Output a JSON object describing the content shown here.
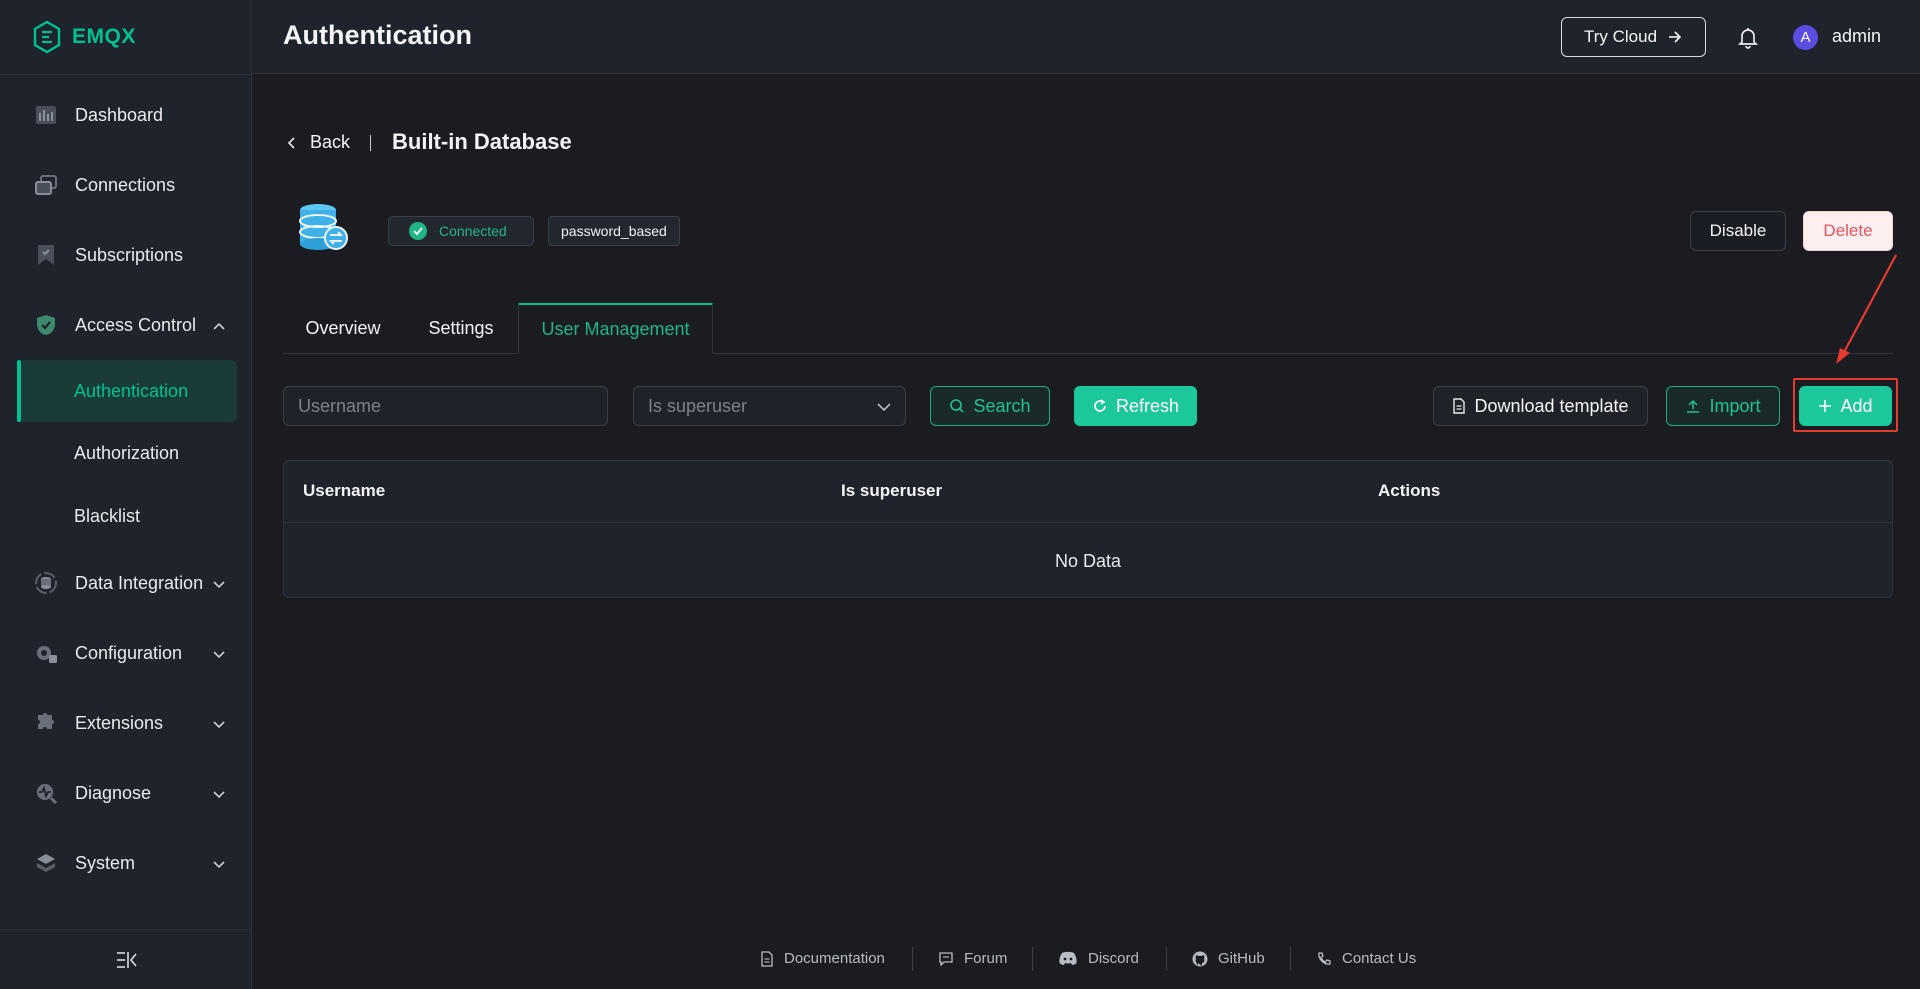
{
  "app": {
    "logo_text": "EMQX",
    "accent": "#00c290"
  },
  "header": {
    "title": "Authentication",
    "try_cloud": "Try Cloud",
    "user": "admin",
    "avatar_letter": "A"
  },
  "sidebar": {
    "items": [
      {
        "label": "Dashboard",
        "icon": "dashboard-icon"
      },
      {
        "label": "Connections",
        "icon": "connections-icon"
      },
      {
        "label": "Subscriptions",
        "icon": "subscriptions-icon"
      },
      {
        "label": "Access Control",
        "icon": "shield-icon",
        "expanded": true
      },
      {
        "label": "Data Integration",
        "icon": "data-integration-icon"
      },
      {
        "label": "Configuration",
        "icon": "gear-icon"
      },
      {
        "label": "Extensions",
        "icon": "puzzle-icon"
      },
      {
        "label": "Diagnose",
        "icon": "diagnose-icon"
      },
      {
        "label": "System",
        "icon": "system-icon"
      }
    ],
    "sub_items": [
      {
        "label": "Authentication",
        "active": true
      },
      {
        "label": "Authorization"
      },
      {
        "label": "Blacklist"
      }
    ]
  },
  "page": {
    "back": "Back",
    "title": "Built-in Database",
    "status": "Connected",
    "mechanism": "password_based",
    "disable": "Disable",
    "delete": "Delete"
  },
  "tabs": [
    {
      "label": "Overview"
    },
    {
      "label": "Settings"
    },
    {
      "label": "User Management",
      "active": true
    }
  ],
  "filters": {
    "username_placeholder": "Username",
    "superuser_placeholder": "Is superuser",
    "search": "Search",
    "refresh": "Refresh",
    "download_template": "Download template",
    "import": "Import",
    "add": "Add"
  },
  "table": {
    "columns": [
      "Username",
      "Is superuser",
      "Actions"
    ],
    "empty_text": "No Data"
  },
  "footer": {
    "links": [
      "Documentation",
      "Forum",
      "Discord",
      "GitHub",
      "Contact Us"
    ]
  }
}
